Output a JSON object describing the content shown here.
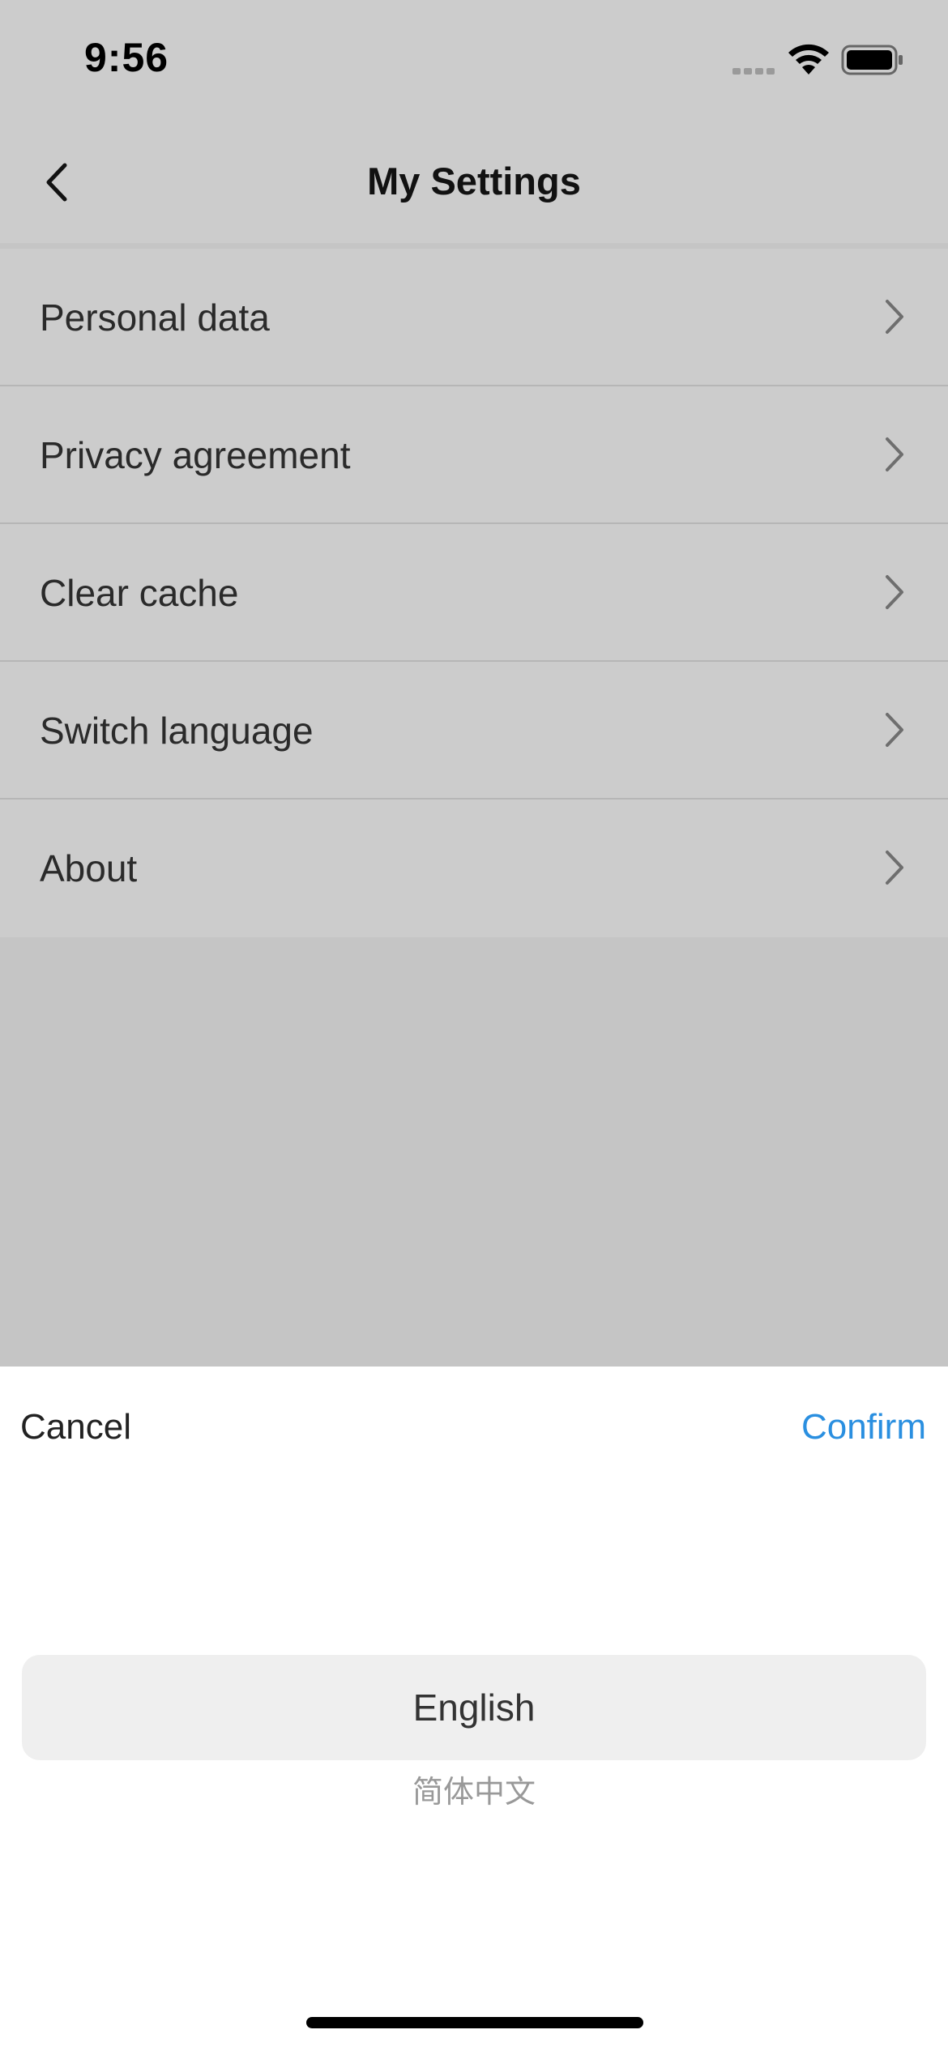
{
  "status_bar": {
    "time": "9:56",
    "icons": [
      "cellular-signal-icon",
      "wifi-icon",
      "battery-icon"
    ]
  },
  "nav": {
    "title": "My Settings",
    "back_icon": "chevron-left-icon"
  },
  "settings": {
    "items": [
      {
        "label": "Personal data"
      },
      {
        "label": "Privacy agreement"
      },
      {
        "label": "Clear cache"
      },
      {
        "label": "Switch language"
      },
      {
        "label": "About"
      }
    ],
    "row_icon": "chevron-right-icon"
  },
  "language_sheet": {
    "cancel_label": "Cancel",
    "confirm_label": "Confirm",
    "options": [
      "English",
      "简体中文"
    ],
    "selected": "English"
  },
  "colors": {
    "accent": "#2a8fe0",
    "overlay": "#c5c5c5",
    "list_background": "#cccccc",
    "sheet_background": "#ffffff",
    "picker_highlight": "#efefef"
  }
}
